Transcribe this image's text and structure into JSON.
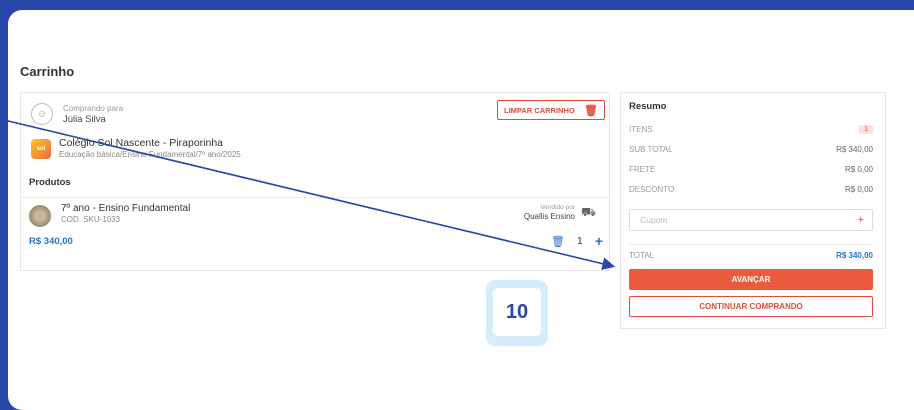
{
  "page": {
    "title": "Carrinho"
  },
  "buyer": {
    "label": "Comprando para",
    "name": "Júlia Silva"
  },
  "clear_button": {
    "label": "LIMPAR CARRINHO"
  },
  "school": {
    "logo_text": "sol",
    "name": "Colégio Sol Nascente - Piraporinha",
    "subtitle": "Educação básica/Ensino Fundamental/7º ano/2025"
  },
  "products_section": {
    "title": "Produtos"
  },
  "product": {
    "name": "7º ano - Ensino Fundamental",
    "code": "COD. SKU-1033",
    "seller_label": "Vendido por",
    "seller_name": "Quallis Ensino",
    "price": "R$ 340,00",
    "quantity": "1"
  },
  "summary": {
    "title": "Resumo",
    "items_label": "ITENS",
    "items_value": "1",
    "subtotal_label": "SUB TOTAL",
    "subtotal_value": "R$ 340,00",
    "freight_label": "FRETE",
    "freight_value": "R$ 0,00",
    "discount_label": "DESCONTO",
    "discount_value": "R$ 0,00",
    "coupon_placeholder": "Cupom",
    "total_label": "TOTAL",
    "total_value": "R$ 340,00",
    "advance_label": "AVANÇAR",
    "continue_label": "CONTINUAR COMPRANDO"
  },
  "step_badge": {
    "number": "10"
  },
  "colors": {
    "accent": "#ea5a3f",
    "link": "#2b73c8",
    "background": "#2748a8",
    "badge_bg": "#d5edfb"
  },
  "icons": {
    "avatar": "user-circle-icon",
    "trash": "trash-icon",
    "truck": "truck-icon",
    "plus": "plus-icon"
  }
}
